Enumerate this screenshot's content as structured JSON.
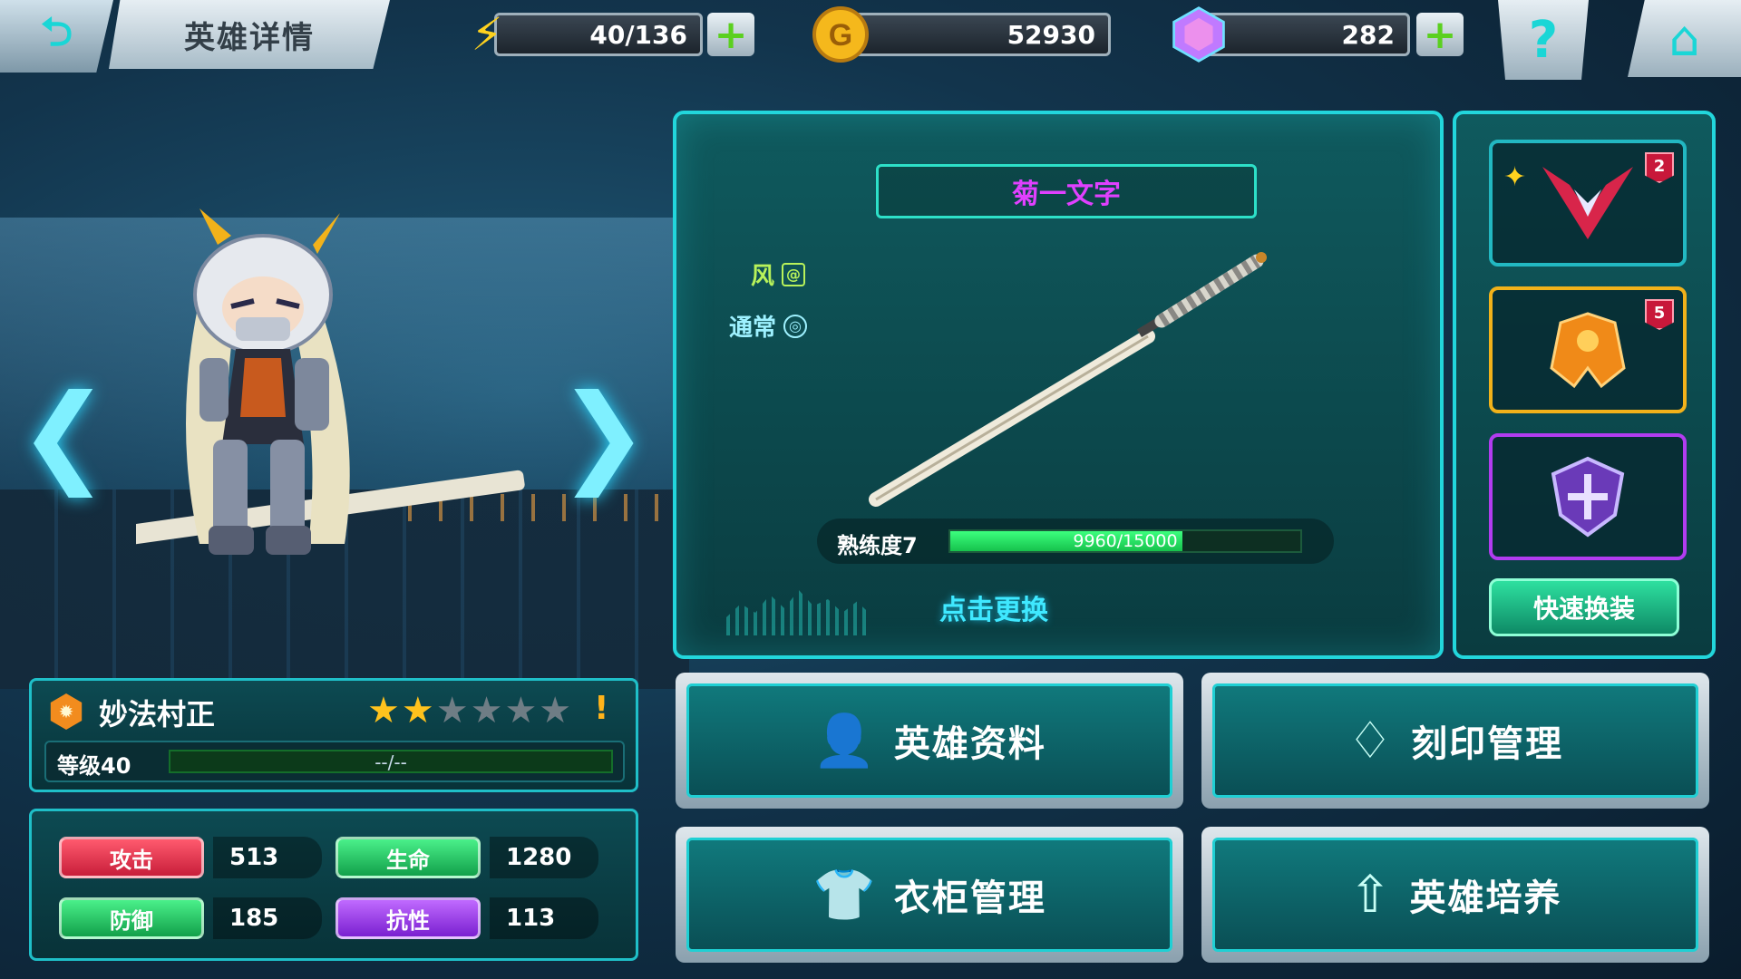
{
  "header": {
    "back_icon": "back-arrow-icon",
    "title": "英雄详情",
    "energy": "40/136",
    "gold": "52930",
    "gems": "282",
    "help_icon": "question-icon",
    "home_icon": "home-icon"
  },
  "hero": {
    "name": "妙法村正",
    "stars_filled": 2,
    "stars_total": 6,
    "level_label": "等级40",
    "exp_text": "--/--",
    "warning": "!"
  },
  "stats": [
    {
      "label": "攻击",
      "value": "513",
      "color": "#e0334d"
    },
    {
      "label": "生命",
      "value": "1280",
      "color": "#1fc05a"
    },
    {
      "label": "防御",
      "value": "185",
      "color": "#1fc05a"
    },
    {
      "label": "抗性",
      "value": "113",
      "color": "#a030e0"
    }
  ],
  "weapon": {
    "name": "菊一文字",
    "element": "风",
    "type": "通常",
    "proficiency_label": "熟练度7",
    "proficiency_text": "9960/15000",
    "proficiency_fraction": 0.664,
    "change_label": "点击更换"
  },
  "equipment": {
    "slots": [
      {
        "name": "slot-1",
        "badge": "2",
        "color": "#22b8c2"
      },
      {
        "name": "slot-2",
        "badge": "5",
        "color": "#f2b21a"
      },
      {
        "name": "slot-3",
        "badge": "",
        "color": "#b23cf0"
      }
    ],
    "quick_label": "快速换装"
  },
  "menu": {
    "hero_info": "英雄资料",
    "imprint": "刻印管理",
    "wardrobe": "衣柜管理",
    "training": "英雄培养"
  }
}
